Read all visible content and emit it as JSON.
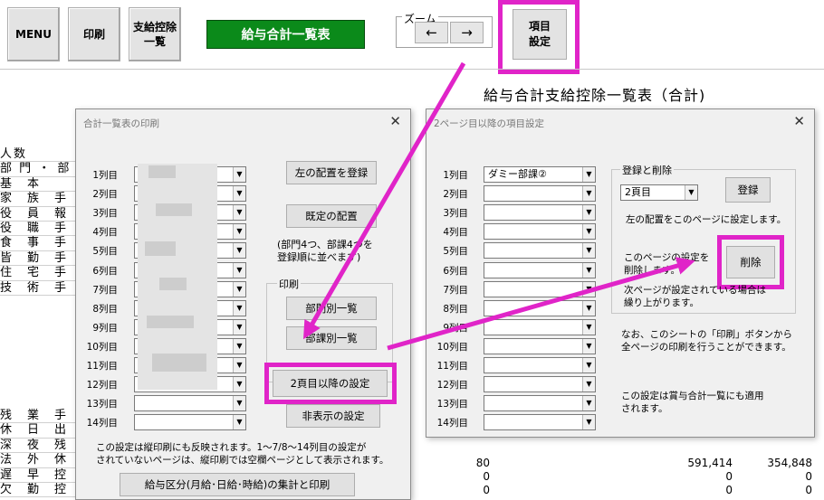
{
  "toolbar": {
    "menu_label": "MENU",
    "print_label": "印刷",
    "deduction_list_label": "支給控除\n一覧",
    "title_label": "給与合計一覧表",
    "zoom_label": "ズーム",
    "zoom_left": "←",
    "zoom_right": "→",
    "item_setting_label": "項目\n設定"
  },
  "sheet": {
    "title": "給与合計支給控除一覧表（合計)",
    "row_labels_top": [
      "人数",
      "部 門 ・ 部",
      "基　本",
      "家　族　手",
      "役　員　報",
      "役　職　手",
      "食　事　手",
      "皆　勤　手",
      "住　宅　手",
      "技　術　手"
    ],
    "row_labels_bottom": [
      "残　業　手",
      "休　日　出",
      "深　夜　残",
      "法　外　休",
      "遅　早　控",
      "欠　勤　控"
    ],
    "rows": [
      {
        "a": "80",
        "b": "591,414",
        "c": "354,848"
      },
      {
        "a": "0",
        "b": "0",
        "c": "0"
      },
      {
        "a": "0",
        "b": "0",
        "c": "0"
      }
    ]
  },
  "dialog_print": {
    "title": "合計一覧表の印刷",
    "close": "✕",
    "rows": [
      "1列目",
      "2列目",
      "3列目",
      "4列目",
      "5列目",
      "6列目",
      "7列目",
      "8列目",
      "9列目",
      "10列目",
      "11列目",
      "12列目",
      "13列目",
      "14列目"
    ],
    "buttons": {
      "register_left": "左の配置を登録",
      "default_layout": "既定の配置",
      "by_dept": "部門別一覧",
      "by_section": "部課別一覧",
      "page2_settings": "2頁目以降の設定",
      "hidden_settings": "非表示の設定",
      "bottom_print": "給与区分(月給･日給･時給)の集計と印刷"
    },
    "note_order": "(部門4つ、部課4つを\n登録順に並べます)",
    "group_print": "印刷",
    "footer_note": "この設定は縦印刷にも反映されます。1～7/8～14列目の設定が\nされていないページは、縦印刷では空欄ページとして表示されます。"
  },
  "dialog_items": {
    "title": "2ページ目以降の項目設定",
    "close": "✕",
    "rows": [
      "1列目",
      "2列目",
      "3列目",
      "4列目",
      "5列目",
      "6列目",
      "7列目",
      "8列目",
      "9列目",
      "10列目",
      "11列目",
      "12列目",
      "13列目",
      "14列目"
    ],
    "row1_value": "ダミー部課②",
    "group_label": "登録と削除",
    "page_value": "2頁目",
    "register_button": "登録",
    "delete_button": "削除",
    "note_set": "左の配置をこのページに設定します。",
    "note_delete": "このページの設定を\n削除します。",
    "note_shift": "次ページが設定されている場合は\n繰り上がります。",
    "note_print": "なお、このシートの「印刷」ボタンから\n全ページの印刷を行うことができます。",
    "note_bonus": "この設定は賞与合計一覧にも適用\nされます。"
  },
  "colors": {
    "highlight": "#e024c8",
    "title_button": "#0b8a1a"
  }
}
